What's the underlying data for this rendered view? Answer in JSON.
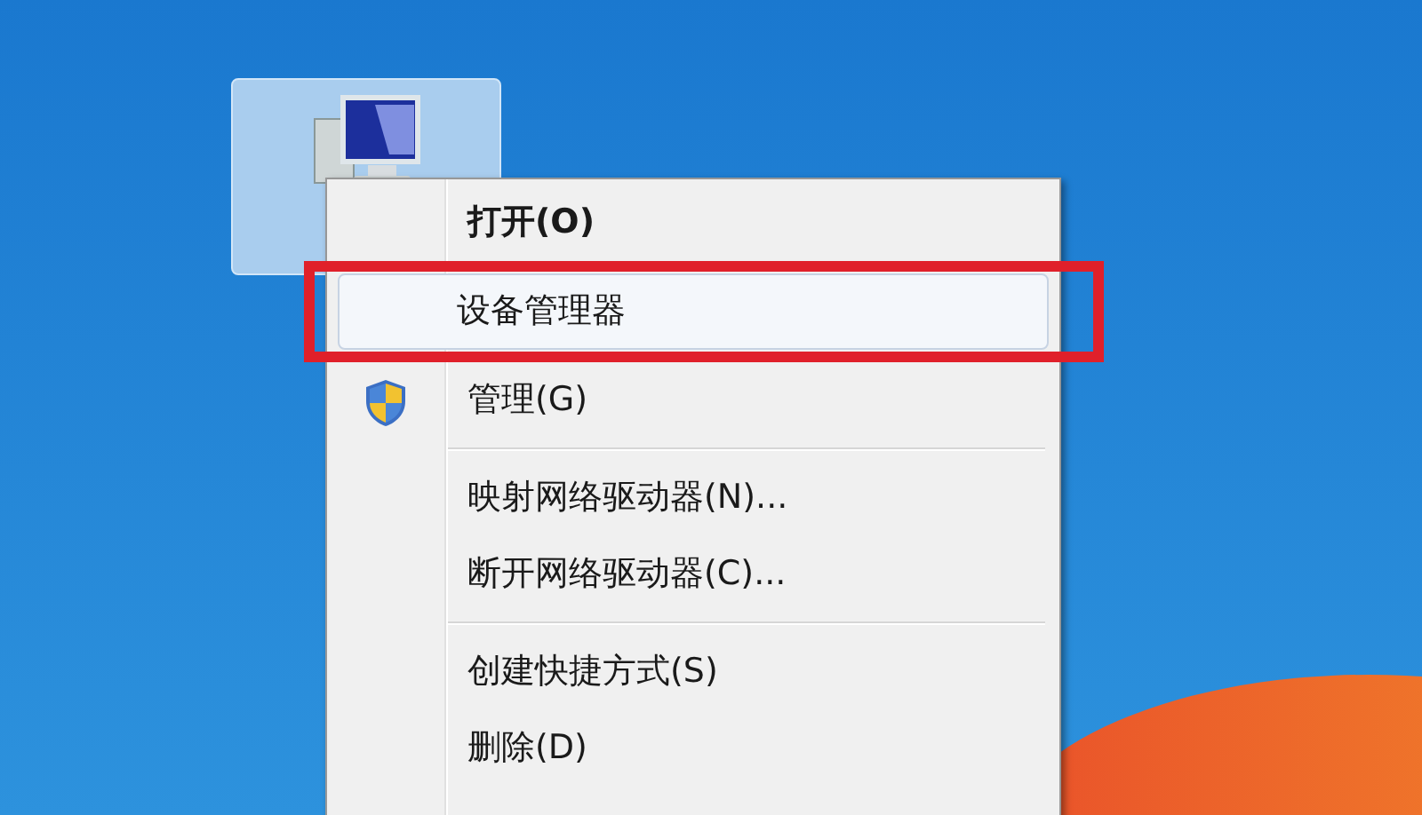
{
  "context_menu": {
    "items": [
      {
        "kind": "command",
        "label": "打开(O)",
        "bold": true,
        "selected": false,
        "elevated": false
      },
      {
        "kind": "command",
        "label": "设备管理器",
        "bold": false,
        "selected": true,
        "elevated": false
      },
      {
        "kind": "command",
        "label": "管理(G)",
        "bold": false,
        "selected": false,
        "elevated": true
      },
      {
        "kind": "separator"
      },
      {
        "kind": "command",
        "label": "映射网络驱动器(N)...",
        "bold": false,
        "selected": false,
        "elevated": false
      },
      {
        "kind": "command",
        "label": "断开网络驱动器(C)...",
        "bold": false,
        "selected": false,
        "elevated": false
      },
      {
        "kind": "separator"
      },
      {
        "kind": "command",
        "label": "创建快捷方式(S)",
        "bold": false,
        "selected": false,
        "elevated": false
      },
      {
        "kind": "command",
        "label": "删除(D)",
        "bold": false,
        "selected": false,
        "elevated": false
      }
    ]
  },
  "desktop_icon": {
    "selected": true
  }
}
